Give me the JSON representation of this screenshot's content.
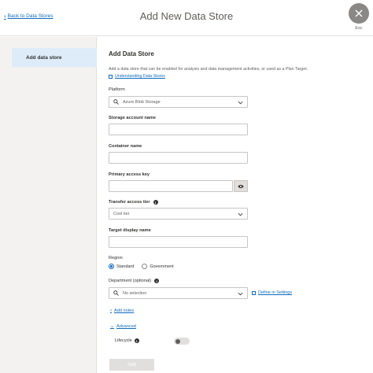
{
  "header": {
    "back_label": "Back to Data Stores",
    "title": "Add New Data Store",
    "esc_label": "Esc"
  },
  "sidebar": {
    "items": [
      {
        "label": "Add data store",
        "selected": true
      }
    ]
  },
  "form": {
    "section_title": "Add Data Store",
    "description": "Add a data store that can be enabled for analysis and data management activities, or used as a Plan Target.",
    "learn_link": "Understanding Data Stores",
    "platform": {
      "label": "Platform",
      "value": "Azure Blob Storage"
    },
    "storage_account": {
      "label": "Storage account name",
      "value": ""
    },
    "container": {
      "label": "Container name",
      "value": ""
    },
    "primary_key": {
      "label": "Primary access key",
      "value": ""
    },
    "transfer_tier": {
      "label": "Transfer access tier",
      "value": "Cool tier"
    },
    "target_display": {
      "label": "Target display name",
      "value": ""
    },
    "region": {
      "label": "Region",
      "options": [
        "Standard",
        "Government"
      ],
      "selected": "Standard"
    },
    "department": {
      "label": "Department (optional)",
      "value": "No selection",
      "define_link": "Define in Settings"
    },
    "add_notes": "Add notes",
    "advanced": "Advanced",
    "lifecycle": {
      "label": "Lifecycle",
      "on": false
    },
    "submit_label": "Add"
  },
  "colors": {
    "accent": "#0f6cbd",
    "sidebar_bg": "#f3f2f1",
    "selected_bg": "#deecf9",
    "disabled_button": "#e1dfdd"
  }
}
